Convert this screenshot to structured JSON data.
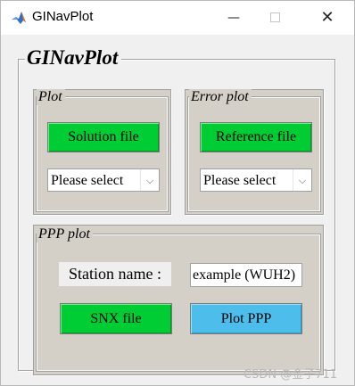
{
  "window": {
    "title": "GINavPlot",
    "min_glyph": "—",
    "close_glyph": "✕",
    "icon": "matlab-icon"
  },
  "main_panel": {
    "title": "GINavPlot"
  },
  "plot_panel": {
    "title": "Plot",
    "button_label": "Solution file",
    "select_value": "Please select",
    "button_color": "#00cc33"
  },
  "error_panel": {
    "title": "Error plot",
    "button_label": "Reference file",
    "select_value": "Please select",
    "button_color": "#00cc33"
  },
  "ppp_panel": {
    "title": "PPP plot",
    "station_label": "Station name :",
    "station_value": "example (WUH2)",
    "snx_button_label": "SNX file",
    "plot_button_label": "Plot PPP",
    "snx_color": "#00cc33",
    "plot_color": "#4dbeeb"
  },
  "watermark": "CSDN @金子711",
  "select_arrow_glyph": "⌵"
}
